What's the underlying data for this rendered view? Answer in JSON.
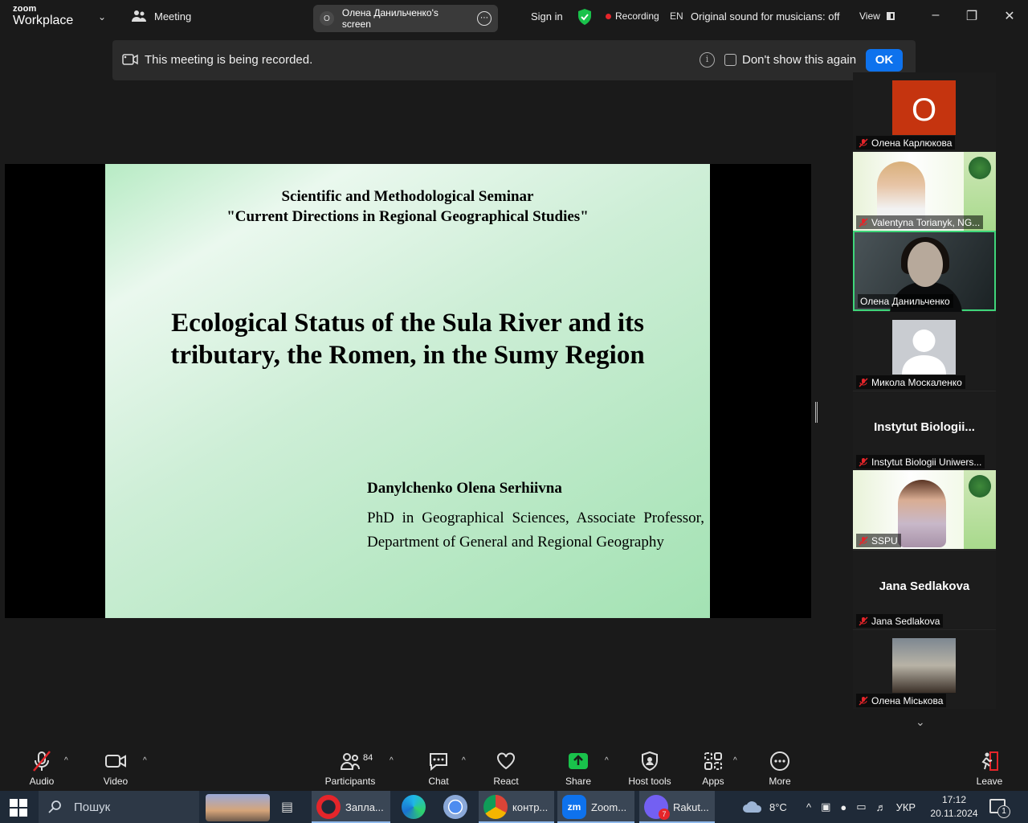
{
  "topbar": {
    "brand_top": "zoom",
    "brand_bottom": "Workplace",
    "meeting_label": "Meeting",
    "screen_initial": "O",
    "screen_label": "Олена Данильченко's screen",
    "signin": "Sign in",
    "recording": "Recording",
    "language": "EN",
    "original_sound": "Original sound for musicians: off",
    "view": "View"
  },
  "banner": {
    "message": "This meeting is being recorded.",
    "info_glyph": "i",
    "dont_show": "Don't show this again",
    "ok": "OK"
  },
  "slide": {
    "seminar_line1": "Scientific and Methodological Seminar",
    "seminar_line2": "\"Current Directions in Regional Geographical Studies\"",
    "title_line1": "Ecological Status of the Sula River and its",
    "title_line2": "tributary, the Romen, in the Sumy Region",
    "author": "Danylchenko Olena Serhiivna",
    "degree": "PhD in Geographical Sciences, Associate Professor, Department of General and Regional Geography"
  },
  "gallery": {
    "participants": [
      {
        "name": "Олена Карлюкова",
        "avatar_letter": "O"
      },
      {
        "name": "Valentynа Torianyk, NG..."
      },
      {
        "name": "Олена Данильченко"
      },
      {
        "name": "Микола Москаленко"
      },
      {
        "big_name": "Instytut  Biologii...",
        "name": "Instytut Biologii Uniwers..."
      },
      {
        "name": "SSPU"
      },
      {
        "big_name": "Jana Sedlakova",
        "name": "Jana Sedlakova"
      },
      {
        "name": "Олена Міськова"
      }
    ]
  },
  "toolbar": {
    "audio": "Audio",
    "video": "Video",
    "participants": "Participants",
    "participants_count": "84",
    "chat": "Chat",
    "react": "React",
    "share": "Share",
    "host_tools": "Host tools",
    "apps": "Apps",
    "more": "More",
    "leave": "Leave"
  },
  "taskbar": {
    "search_placeholder": "Пошук",
    "apps": [
      {
        "label": "Запла..."
      },
      {
        "label": "контр..."
      },
      {
        "label": "Zoom..."
      },
      {
        "label": "Rakut...",
        "badge": "7"
      }
    ],
    "temperature": "8°C",
    "lang": "УКР",
    "time": "17:12",
    "date": "20.11.2024",
    "notifications": "1"
  },
  "colors": {
    "accent": "#0e72ed",
    "recording_dot": "#e5252a",
    "active_speaker": "#3fd67a",
    "share_green": "#19c24b",
    "leave_red": "#e5252a"
  }
}
